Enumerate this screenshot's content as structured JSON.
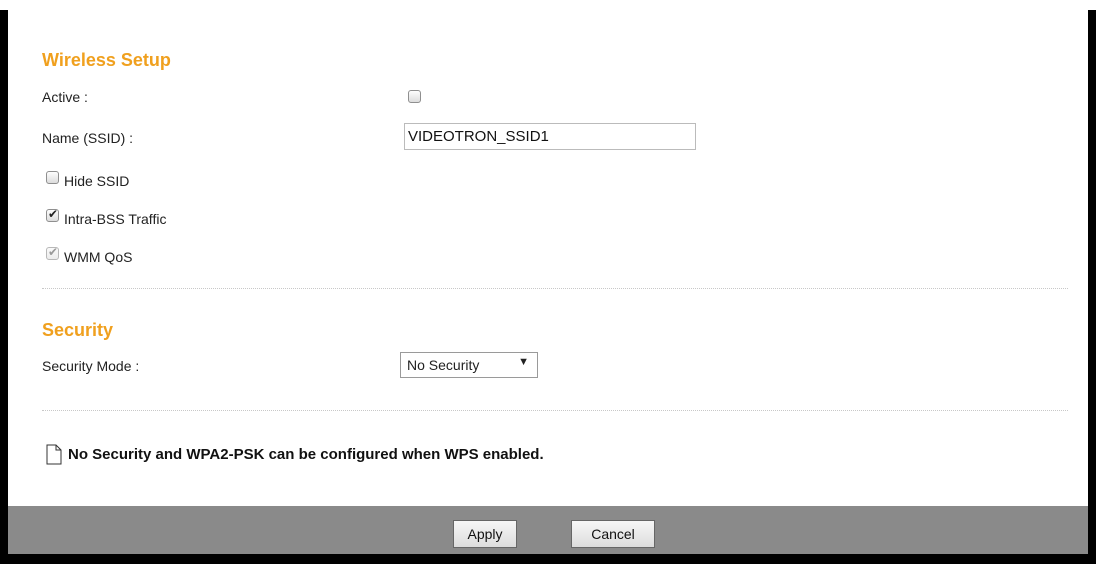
{
  "wireless_setup": {
    "title": "Wireless Setup",
    "active_label": "Active :",
    "active_checked": false,
    "ssid_label": "Name (SSID) :",
    "ssid_value": "VIDEOTRON_SSID1",
    "options": [
      {
        "label": "Hide SSID",
        "checked": false,
        "disabled": false
      },
      {
        "label": "Intra-BSS Traffic",
        "checked": true,
        "disabled": false
      },
      {
        "label": "WMM QoS",
        "checked": true,
        "disabled": true
      }
    ]
  },
  "security": {
    "title": "Security",
    "mode_label": "Security Mode :",
    "mode_value": "No Security",
    "dropdown_arrow": "▼"
  },
  "note": {
    "icon": "note-icon",
    "text": "No Security and WPA2-PSK can be configured when WPS enabled."
  },
  "footer": {
    "apply_label": "Apply",
    "cancel_label": "Cancel"
  }
}
